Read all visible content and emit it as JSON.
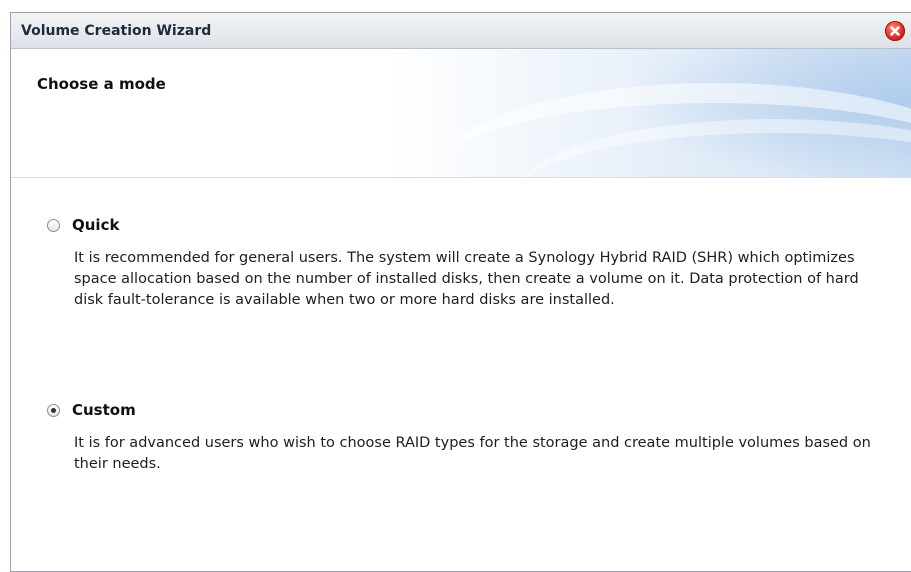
{
  "window": {
    "title": "Volume Creation Wizard",
    "close_icon": "close-icon"
  },
  "header": {
    "title": "Choose a mode"
  },
  "options": [
    {
      "label": "Quick",
      "selected": false,
      "description": "It is recommended for general users. The system will create a Synology Hybrid RAID (SHR) which optimizes space allocation based on the number of installed disks, then create a volume on it. Data protection of hard disk fault-tolerance is available when two or more hard disks are installed."
    },
    {
      "label": "Custom",
      "selected": true,
      "description": "It is for advanced users who wish to choose RAID types for the storage and create multiple volumes based on their needs."
    }
  ],
  "colors": {
    "close_button": "#d8261c",
    "title_text": "#1d2b3a"
  }
}
